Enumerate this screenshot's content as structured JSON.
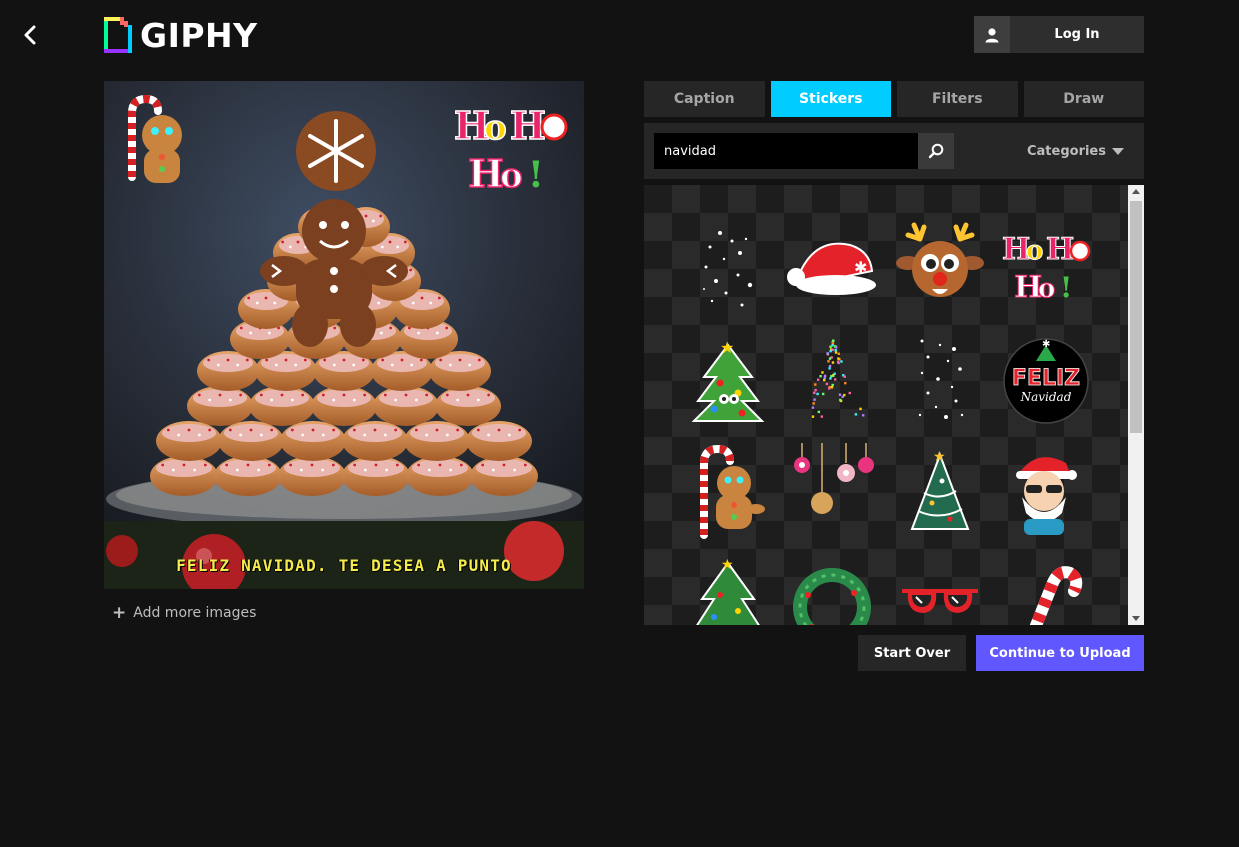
{
  "header": {
    "logo_text": "GIPHY",
    "login_label": "Log In",
    "icons": {
      "back": "chevron-left-icon",
      "user": "user-icon"
    }
  },
  "preview": {
    "caption": "FELIZ NAVIDAD. TE DESEA A PUNTO",
    "add_more_label": "Add more images"
  },
  "tabs": [
    {
      "label": "Caption",
      "active": false
    },
    {
      "label": "Stickers",
      "active": true
    },
    {
      "label": "Filters",
      "active": false
    },
    {
      "label": "Draw",
      "active": false
    }
  ],
  "search": {
    "value": "navidad",
    "categories_label": "Categories"
  },
  "stickers": [
    "snow-sparkles",
    "santa-hat",
    "reindeer",
    "ho-ho-ho",
    "christmas-tree",
    "confetti-tree",
    "white-sparkles",
    "feliz-navidad-badge",
    "gingerbread-candy-cane",
    "ornaments",
    "decorated-tree",
    "cool-santa",
    "small-tree",
    "wreath",
    "heart-sunglasses",
    "candy-cane"
  ],
  "actions": {
    "start_over_label": "Start Over",
    "continue_label": "Continue to Upload"
  },
  "colors": {
    "accent_tab": "#00ccff",
    "continue_button": "#6157ff",
    "background": "#121212"
  }
}
